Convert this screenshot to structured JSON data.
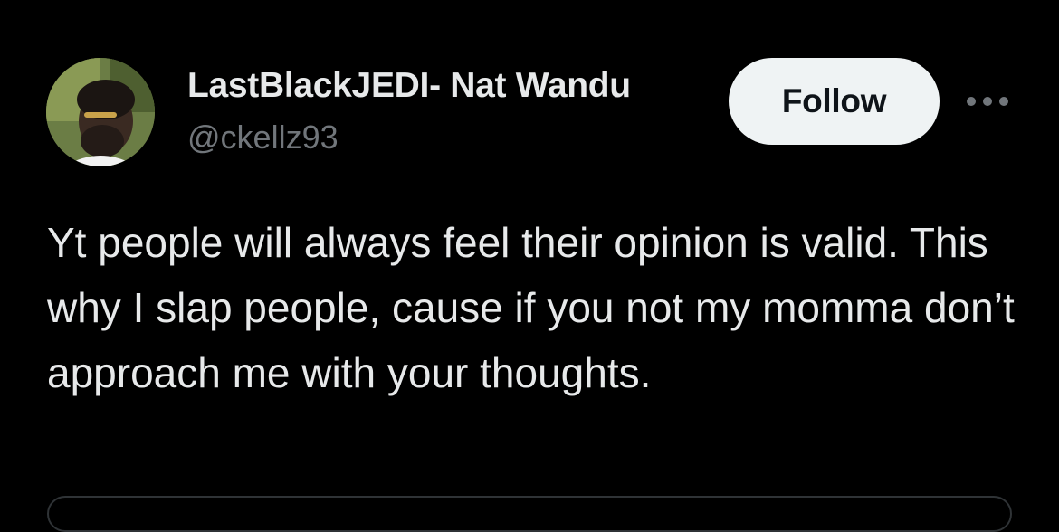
{
  "tweet": {
    "author": {
      "display_name": "LastBlackJEDI- Nat Wandu",
      "handle": "@ckellz93",
      "avatar_icon": "user-avatar"
    },
    "follow_label": "Follow",
    "more_icon": "more-horizontal-icon",
    "text": "Yt people will always feel their opinion is valid. This why I slap people, cause if you not my momma don’t approach me with your thoughts."
  },
  "colors": {
    "background": "#000000",
    "primary_text": "#e7e9ea",
    "secondary_text": "#71767b",
    "follow_button_bg": "#eff3f4",
    "follow_button_text": "#0f1419",
    "border": "#2f3336"
  }
}
